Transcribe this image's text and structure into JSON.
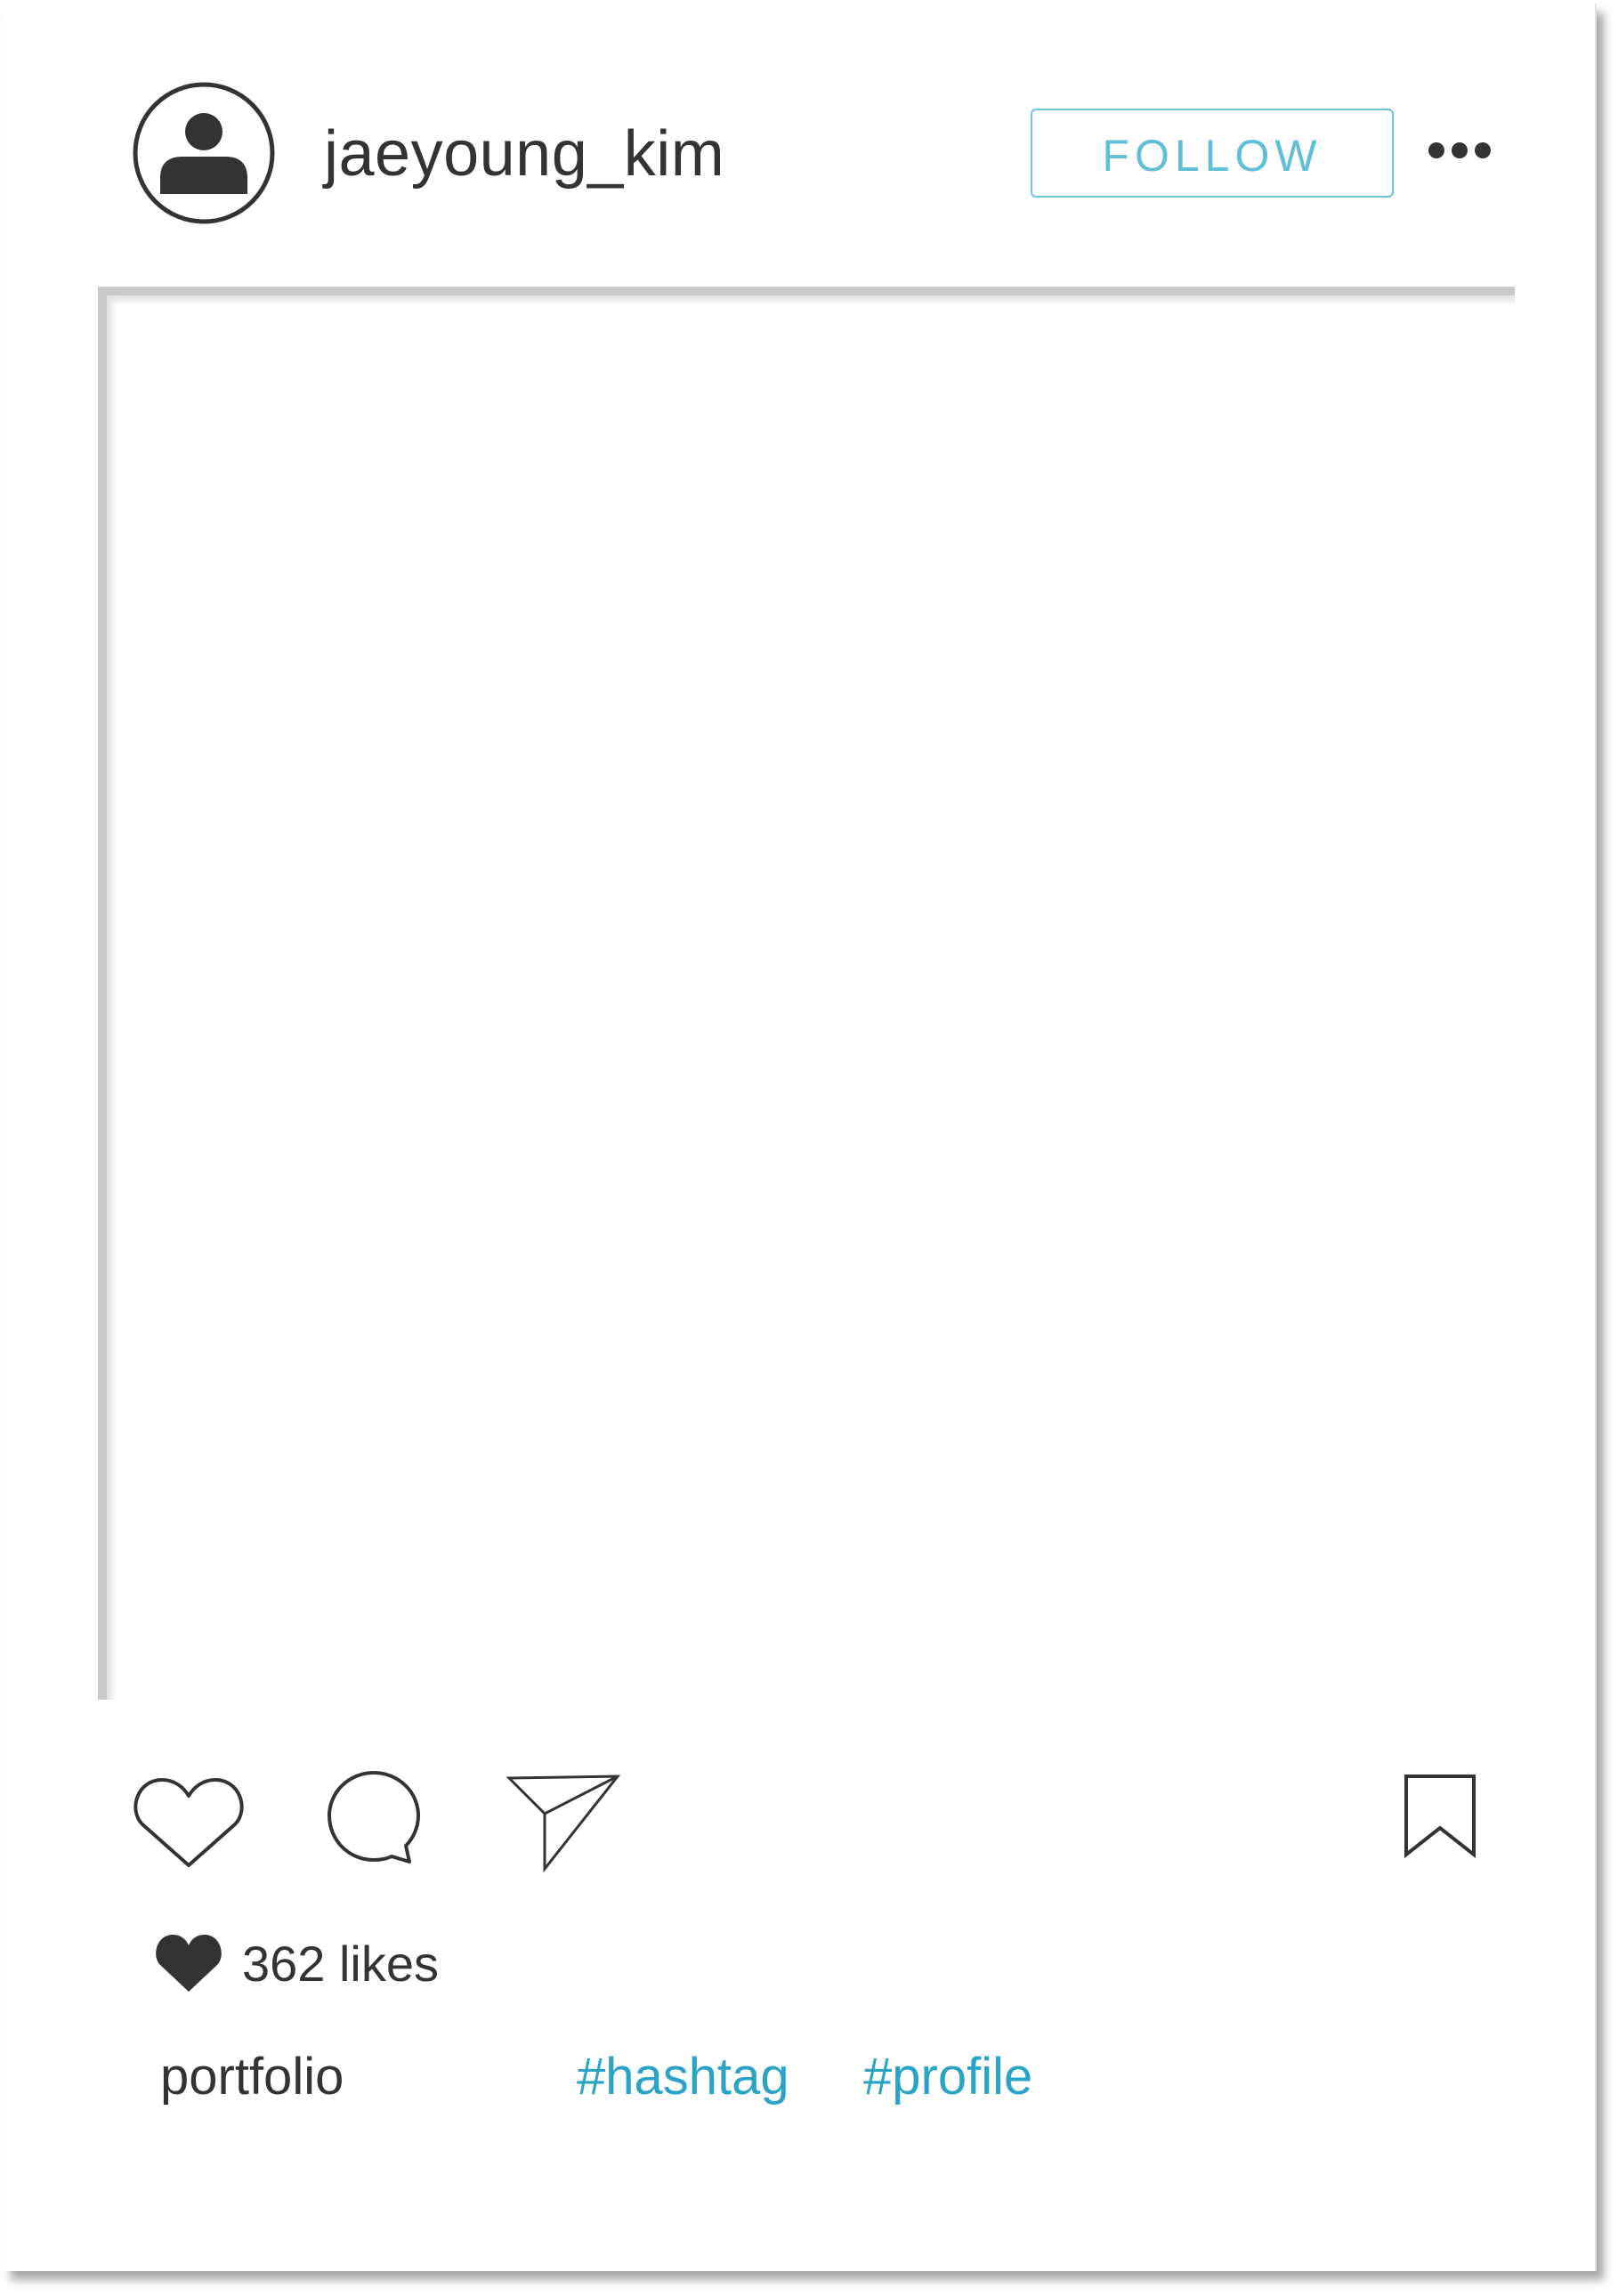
{
  "post": {
    "username": "jaeyoung_kim",
    "follow_label": "FOLLOW",
    "likes_text": "362 likes",
    "caption_user": "portfolio",
    "hashtags": [
      "#hashtag",
      "#profile"
    ]
  },
  "icons": {
    "avatar": "user-avatar-icon",
    "more": "more-options-icon",
    "like": "heart-icon",
    "comment": "comment-icon",
    "share": "send-icon",
    "save": "bookmark-icon",
    "likes_indicator": "filled-heart-icon"
  },
  "colors": {
    "accent": "#5fbfd4",
    "hashtag": "#2ba3c4",
    "text": "#333333"
  }
}
